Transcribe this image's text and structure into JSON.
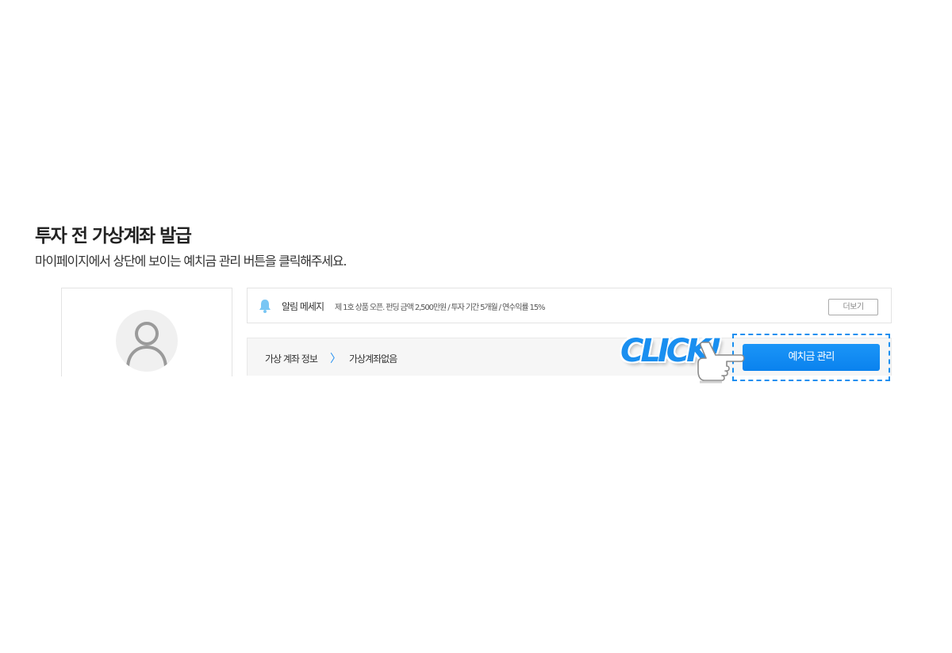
{
  "heading": {
    "title": "투자 전 가상계좌 발급",
    "subtitle": "마이페이지에서 상단에 보이는 예치금 관리 버튼을 클릭해주세요."
  },
  "profile": {
    "avatar_icon": "user-avatar-icon"
  },
  "notice": {
    "icon": "bell-icon",
    "label": "알림 메세지",
    "text": "제 1호 상품 오픈. 펀딩 금액 2,500만원 / 투자 기간 5개월 / 연수익률 15%",
    "more_label": "더보기"
  },
  "account": {
    "label": "가상 계좌 정보",
    "separator": "〉",
    "status": "가상계좌없음",
    "deposit_button_label": "예치금 관리"
  },
  "annotation": {
    "click_label": "CLICK!",
    "cursor_icon": "hand-cursor-icon"
  },
  "colors": {
    "accent": "#1a8ff0",
    "border": "#e3e3e3",
    "account_bg": "#f6f6f6",
    "bell": "#79c6f4"
  }
}
